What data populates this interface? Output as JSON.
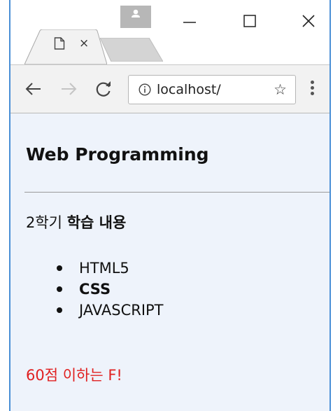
{
  "browser": {
    "tab": {
      "close_glyph": "×",
      "icon": "page-icon"
    },
    "window_controls": {
      "minimize": "—",
      "maximize": "☐",
      "close": "✕"
    },
    "toolbar": {
      "url": "localhost/",
      "info_icon": "info-icon",
      "star_glyph": "☆"
    }
  },
  "page": {
    "heading": "Web Programming",
    "paragraph": {
      "prefix": "2학기 ",
      "bold": "학습 내용"
    },
    "list": [
      {
        "label": "HTML5"
      },
      {
        "label": "CSS"
      },
      {
        "label": "JAVASCRIPT"
      }
    ],
    "note": "60점 이하는 F!"
  },
  "colors": {
    "window_border": "#4a8fd6",
    "content_bg": "#eef3fb",
    "toolbar_bg": "#f2f2f2",
    "note_text": "#e02020"
  }
}
